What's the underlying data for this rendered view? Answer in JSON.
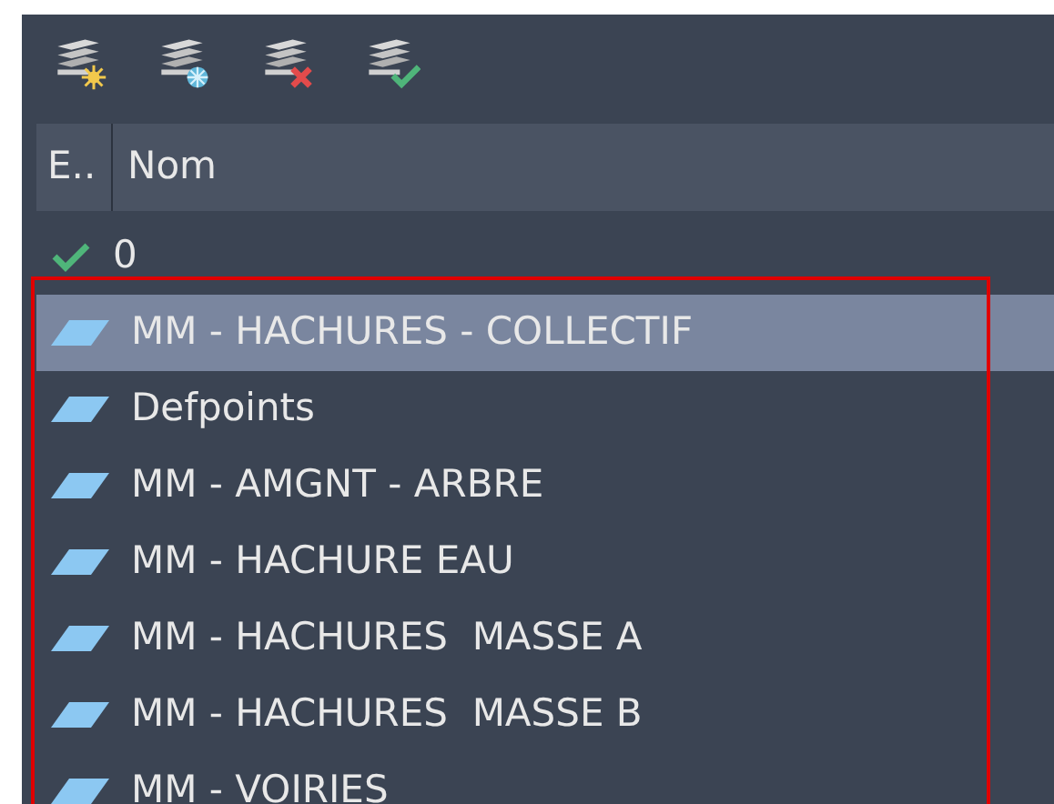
{
  "toolbar": {
    "buttons": [
      {
        "kind": "new"
      },
      {
        "kind": "freeze"
      },
      {
        "kind": "delete"
      },
      {
        "kind": "current"
      }
    ]
  },
  "columns": [
    "E..",
    "Nom"
  ],
  "rows": [
    {
      "kind": "current",
      "name": "0",
      "selected": false
    },
    {
      "kind": "layer",
      "name": "MM - HACHURES - COLLECTIF",
      "selected": true
    },
    {
      "kind": "layer",
      "name": "Defpoints",
      "selected": false
    },
    {
      "kind": "layer",
      "name": "MM - AMGNT - ARBRE",
      "selected": false
    },
    {
      "kind": "layer",
      "name": "MM - HACHURE EAU",
      "selected": false
    },
    {
      "kind": "layer",
      "name": "MM - HACHURES  MASSE A",
      "selected": false
    },
    {
      "kind": "layer",
      "name": "MM - HACHURES  MASSE B",
      "selected": false
    },
    {
      "kind": "layer",
      "name": "MM - VOIRIES",
      "selected": false
    }
  ],
  "annotation_frame": true
}
